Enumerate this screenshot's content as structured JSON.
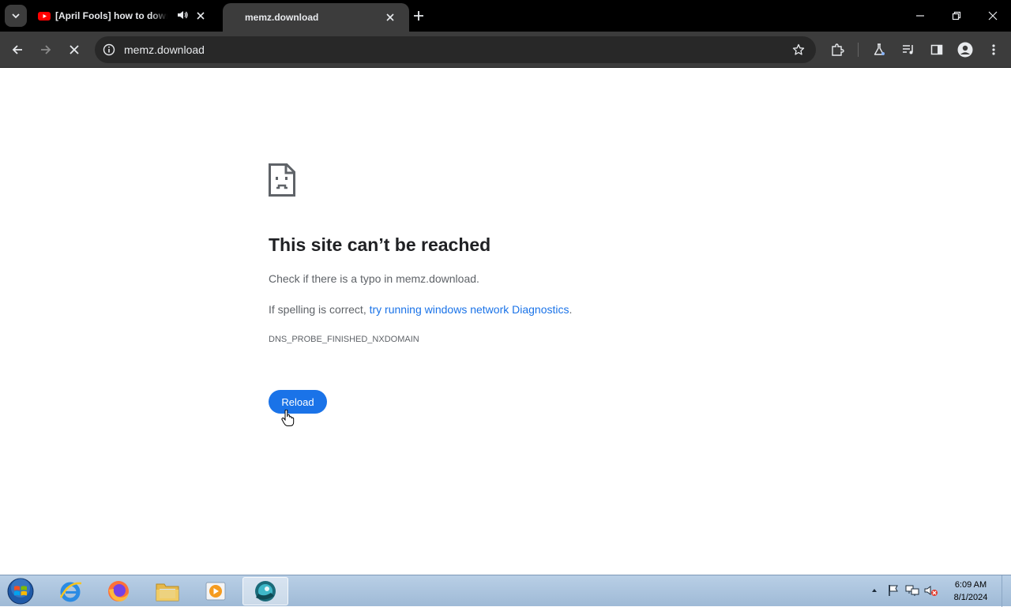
{
  "browser": {
    "tabs": [
      {
        "title": "[April Fools] how to download MEMZ",
        "favicon": "youtube-icon",
        "audio": true,
        "active": false
      },
      {
        "title": "memz.download",
        "active": true
      }
    ],
    "url": "memz.download"
  },
  "error_page": {
    "title": "This site can’t be reached",
    "line1": "Check if there is a typo in memz.download.",
    "line2_prefix": "If spelling is correct, ",
    "line2_link": "try running windows network Diagnostics",
    "line2_suffix": ".",
    "code": "DNS_PROBE_FINISHED_NXDOMAIN",
    "reload_label": "Reload"
  },
  "taskbar": {
    "apps": [
      "internet-explorer-icon",
      "firefox-icon",
      "file-explorer-icon",
      "media-player-icon",
      "chrome-app-icon"
    ],
    "time": "6:09 AM",
    "date": "8/1/2024"
  },
  "colors": {
    "accent": "#1a73e8",
    "tabstrip": "#000000",
    "toolbar": "#3c3c3c"
  }
}
